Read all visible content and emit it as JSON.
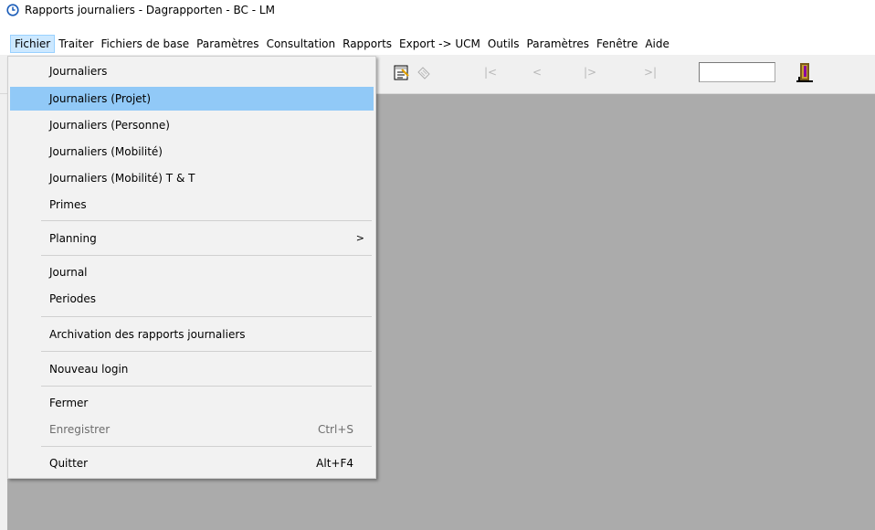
{
  "window": {
    "title": "Rapports journaliers - Dagrapporten - BC - LM",
    "icon": "clock-icon"
  },
  "menubar": [
    {
      "label": "Fichier",
      "active": true
    },
    {
      "label": "Traiter"
    },
    {
      "label": "Fichiers de base"
    },
    {
      "label": "Paramètres"
    },
    {
      "label": "Consultation"
    },
    {
      "label": "Rapports"
    },
    {
      "label": "Export -> UCM"
    },
    {
      "label": "Outils"
    },
    {
      "label": "Paramètres"
    },
    {
      "label": "Fenêtre"
    },
    {
      "label": "Aide"
    }
  ],
  "toolbar": {
    "icons": [
      "edit-sheet-icon",
      "disabled-sheet-icon",
      "first-record-icon",
      "previous-record-icon",
      "next-record-icon",
      "last-record-icon",
      "exit-door-icon"
    ],
    "nav_first": "|<",
    "nav_prev": "<",
    "nav_next": "|>",
    "nav_last": ">|",
    "field_value": ""
  },
  "fichier_menu": {
    "items": [
      {
        "label": "Journaliers"
      },
      {
        "label": "Journaliers (Projet)",
        "highlighted": true
      },
      {
        "label": "Journaliers (Personne)"
      },
      {
        "label": "Journaliers (Mobilité)"
      },
      {
        "label": "Journaliers (Mobilité) T & T"
      },
      {
        "label": "Primes"
      },
      {
        "label": "Planning",
        "submenu": true,
        "arrow": ">"
      },
      {
        "label": "Journal"
      },
      {
        "label": "Periodes"
      },
      {
        "label": "Archivation des rapports journaliers"
      },
      {
        "label": "Nouveau login"
      },
      {
        "label": "Fermer"
      },
      {
        "label": "Enregistrer",
        "shortcut": "Ctrl+S",
        "disabled": true
      },
      {
        "label": "Quitter",
        "shortcut": "Alt+F4"
      }
    ]
  },
  "colors": {
    "menu_highlight": "#91c9f7",
    "active_menu_bg": "#cce8ff",
    "workspace": "#ababab"
  }
}
